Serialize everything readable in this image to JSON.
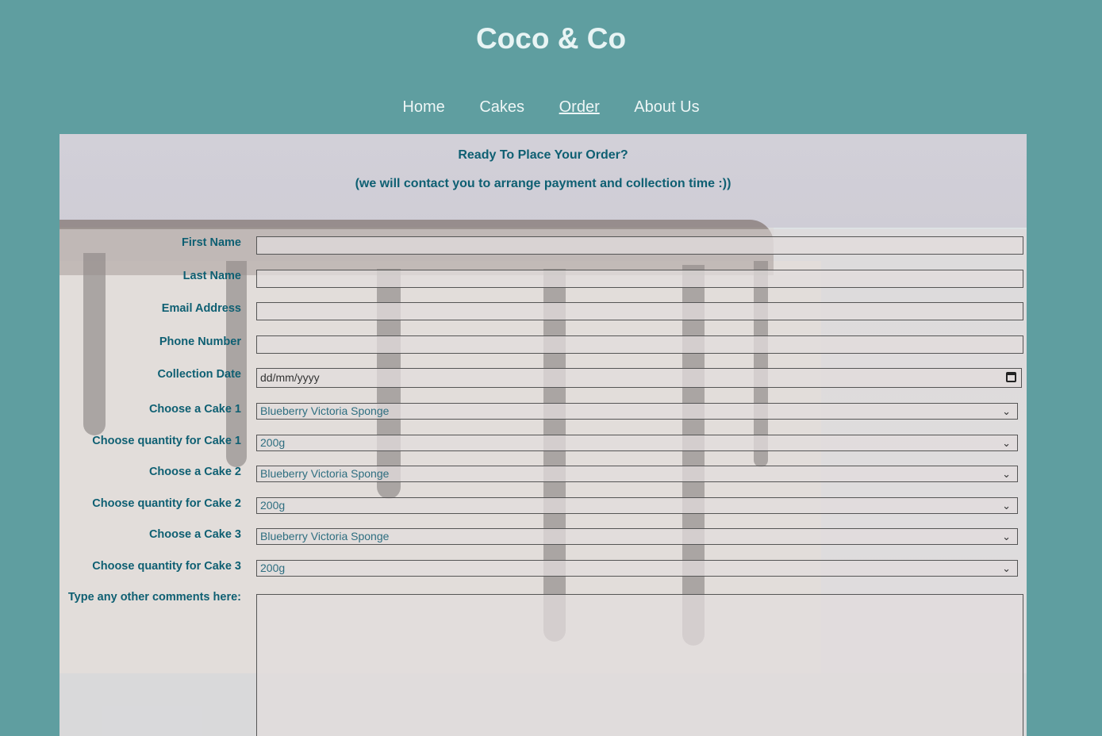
{
  "site": {
    "title": "Coco & Co"
  },
  "nav": {
    "items": [
      {
        "label": "Home"
      },
      {
        "label": "Cakes"
      },
      {
        "label": "Order"
      },
      {
        "label": "About Us"
      }
    ]
  },
  "order": {
    "heading": "Ready To Place Your Order?",
    "subheading": "(we will contact you to arrange payment and collection time :))",
    "fields": {
      "first_name_label": "First Name",
      "last_name_label": "Last Name",
      "email_label": "Email Address",
      "phone_label": "Phone Number",
      "collection_date_label": "Collection Date",
      "collection_date_value": "dd/mm/yyyy",
      "cake1_label": "Choose a Cake 1",
      "cake1_value": "Blueberry Victoria Sponge",
      "qty1_label": "Choose quantity for Cake 1",
      "qty1_value": "200g",
      "cake2_label": "Choose a Cake 2",
      "cake2_value": "Blueberry Victoria Sponge",
      "qty2_label": "Choose quantity for Cake 2",
      "qty2_value": "200g",
      "cake3_label": "Choose a Cake 3",
      "cake3_value": "Blueberry Victoria Sponge",
      "qty3_label": "Choose quantity for Cake 3",
      "qty3_value": "200g",
      "comments_label": "Type any other comments here:"
    }
  },
  "colors": {
    "page_background": "#5f9ea0",
    "label_text": "#0e5f72",
    "title_text": "#e8f4f4"
  }
}
